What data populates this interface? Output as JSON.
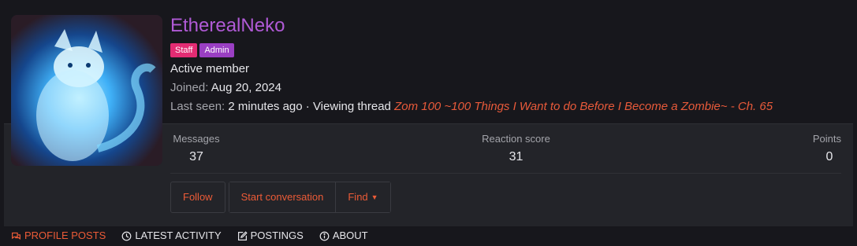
{
  "profile": {
    "username": "EtherealNeko",
    "badges": [
      "Staff",
      "Admin"
    ],
    "user_title": "Active member",
    "joined_label": "Joined:",
    "joined_value": "Aug 20, 2024",
    "lastseen_label": "Last seen:",
    "lastseen_value": "2 minutes ago · Viewing thread",
    "thread_title": "Zom 100 ~100 Things I Want to do Before I Become a Zombie~ - Ch. 65",
    "avatar_icon": "avatar-blue-cat-icon"
  },
  "stats": [
    {
      "label": "Messages",
      "value": "37"
    },
    {
      "label": "Reaction score",
      "value": "31"
    },
    {
      "label": "Points",
      "value": "0"
    }
  ],
  "actions": {
    "follow": "Follow",
    "start_conversation": "Start conversation",
    "find": "Find"
  },
  "tabs": [
    {
      "label": "PROFILE POSTS",
      "icon": "comments-icon",
      "active": true
    },
    {
      "label": "LATEST ACTIVITY",
      "icon": "clock-icon",
      "active": false
    },
    {
      "label": "POSTINGS",
      "icon": "edit-icon",
      "active": false
    },
    {
      "label": "ABOUT",
      "icon": "info-icon",
      "active": false
    }
  ],
  "colors": {
    "background": "#17171c",
    "panel": "#232429",
    "username": "#b05ad6",
    "accent": "#ec5b37",
    "staff_badge": "#e32c73",
    "admin_badge": "#9a3fc3"
  }
}
